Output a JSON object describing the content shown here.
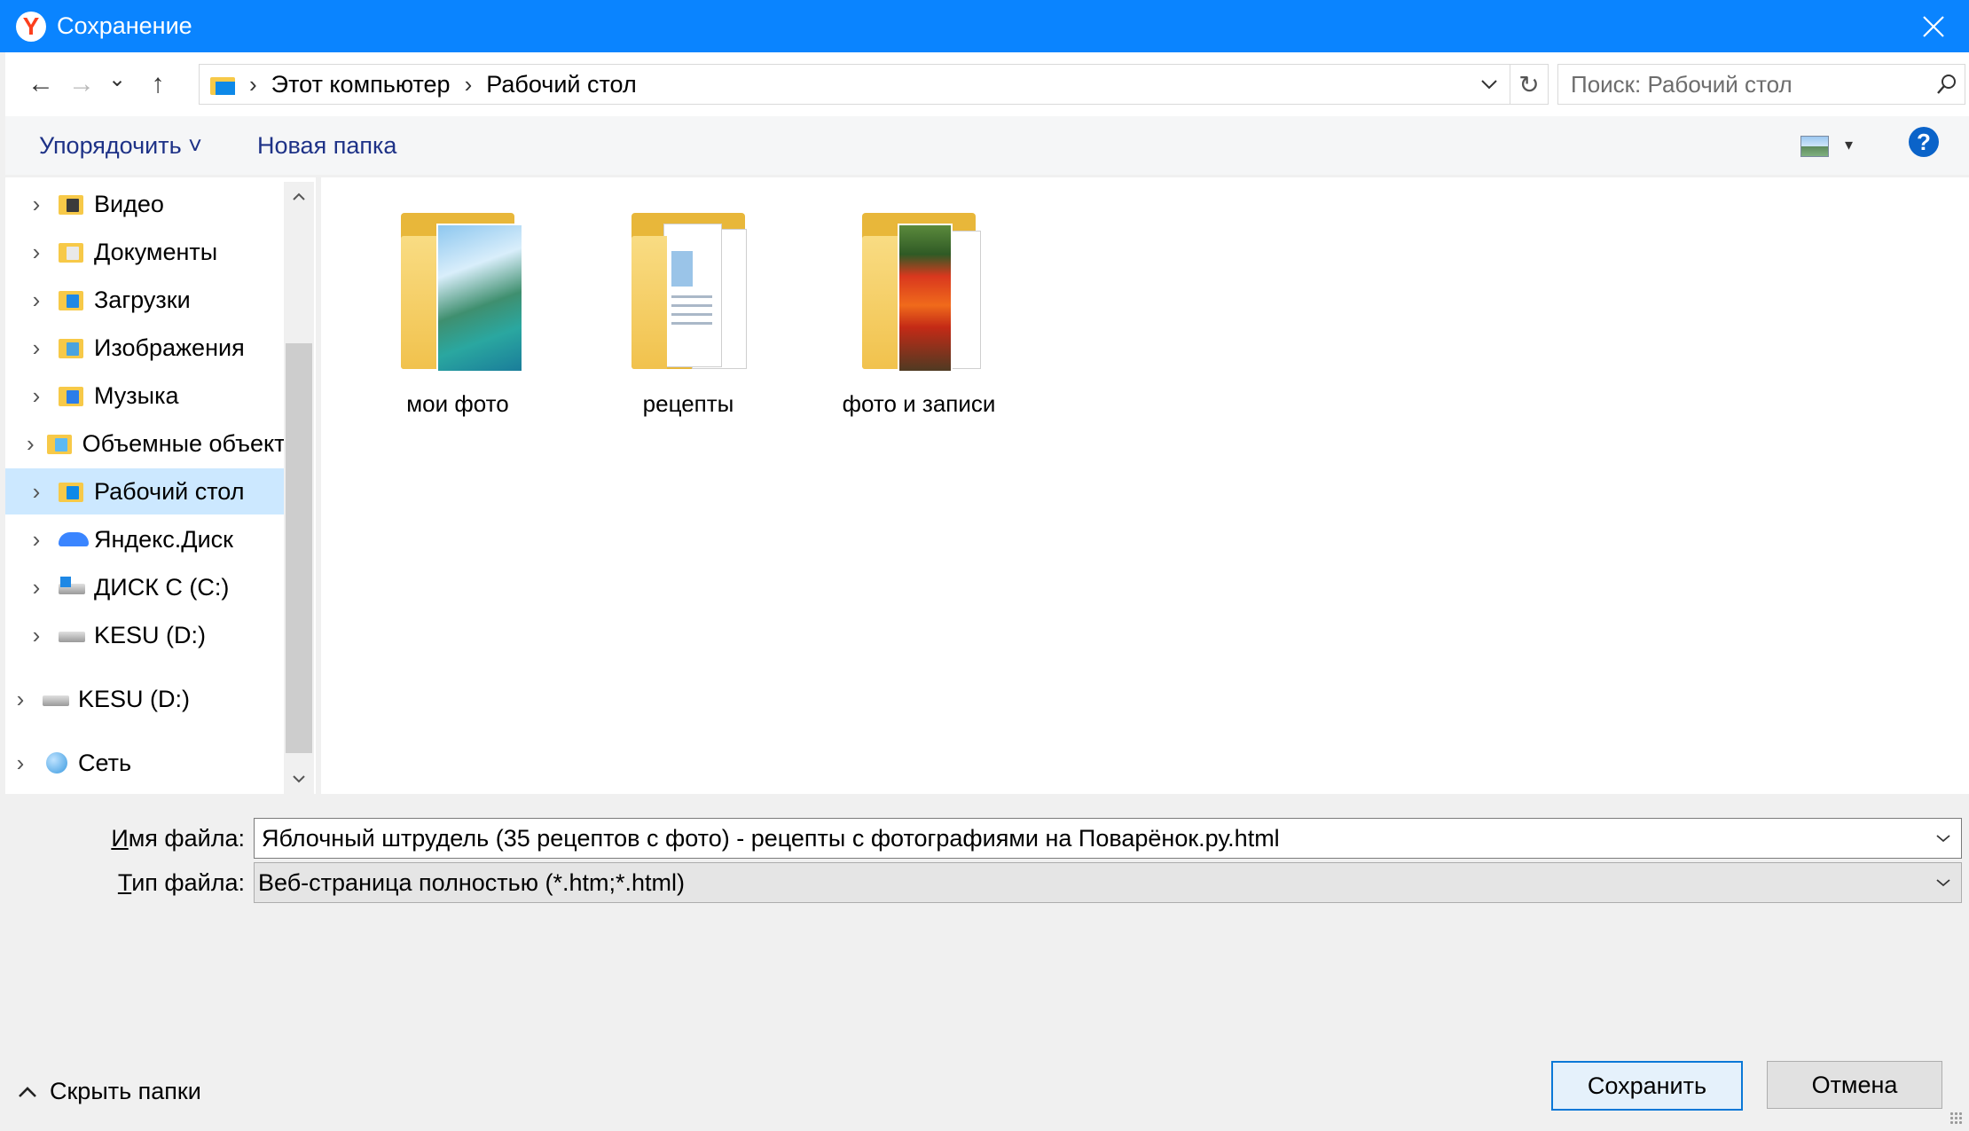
{
  "window": {
    "title": "Сохранение",
    "app_logo_letter": "Y"
  },
  "nav": {
    "back": "←",
    "forward": "→",
    "recent": "⌄",
    "up": "↑",
    "breadcrumb": [
      "Этот компьютер",
      "Рабочий стол"
    ],
    "refresh": "↻",
    "search_placeholder": "Поиск: Рабочий стол"
  },
  "toolbar": {
    "organize": "Упорядочить ˅",
    "new_folder": "Новая папка",
    "help": "?"
  },
  "tree": [
    {
      "label": "Видео",
      "icon": "video-folder-icon",
      "color": "#3b3b3b"
    },
    {
      "label": "Документы",
      "icon": "documents-folder-icon",
      "color": "#e9e9e9"
    },
    {
      "label": "Загрузки",
      "icon": "downloads-folder-icon",
      "color": "#1e88e5"
    },
    {
      "label": "Изображения",
      "icon": "pictures-folder-icon",
      "color": "#4aa3df"
    },
    {
      "label": "Музыка",
      "icon": "music-folder-icon",
      "color": "#2b7de9"
    },
    {
      "label": "Объемные объекты",
      "icon": "3d-objects-folder-icon",
      "color": "#5cb9f2"
    },
    {
      "label": "Рабочий стол",
      "icon": "desktop-folder-icon",
      "color": "#0e89e8",
      "selected": true
    },
    {
      "label": "Яндекс.Диск",
      "icon": "yandex-disk-icon",
      "color": "#3a85ff"
    },
    {
      "label": "ДИСК C (C:)",
      "icon": "system-drive-icon",
      "color": "#1e88e5"
    },
    {
      "label": "KESU (D:)",
      "icon": "drive-icon",
      "color": "#9e9e9e"
    },
    {
      "label": "KESU (D:)",
      "icon": "removable-drive-icon",
      "color": "#9e9e9e"
    },
    {
      "label": "Сеть",
      "icon": "network-icon",
      "color": "#3a9ae0"
    }
  ],
  "files": [
    {
      "name": "мои фото",
      "preview": "photo-beach"
    },
    {
      "name": "рецепты",
      "preview": "documents"
    },
    {
      "name": "фото и записи",
      "preview": "photo-tulips"
    }
  ],
  "form": {
    "filename_label": "Имя файла:",
    "filename_accel": "И",
    "filename_rest": "мя файла:",
    "filename_value": "Яблочный штрудель (35 рецептов с фото) - рецепты с фотографиями на Поварёнок.ру.html",
    "filetype_label": "Тип файла:",
    "filetype_accel": "Т",
    "filetype_rest": "ип файла:",
    "filetype_value": "Веб-страница полностью (*.htm;*.html)"
  },
  "footer": {
    "hide_folders": "Скрыть папки",
    "save": "Сохранить",
    "cancel": "Отмена"
  }
}
